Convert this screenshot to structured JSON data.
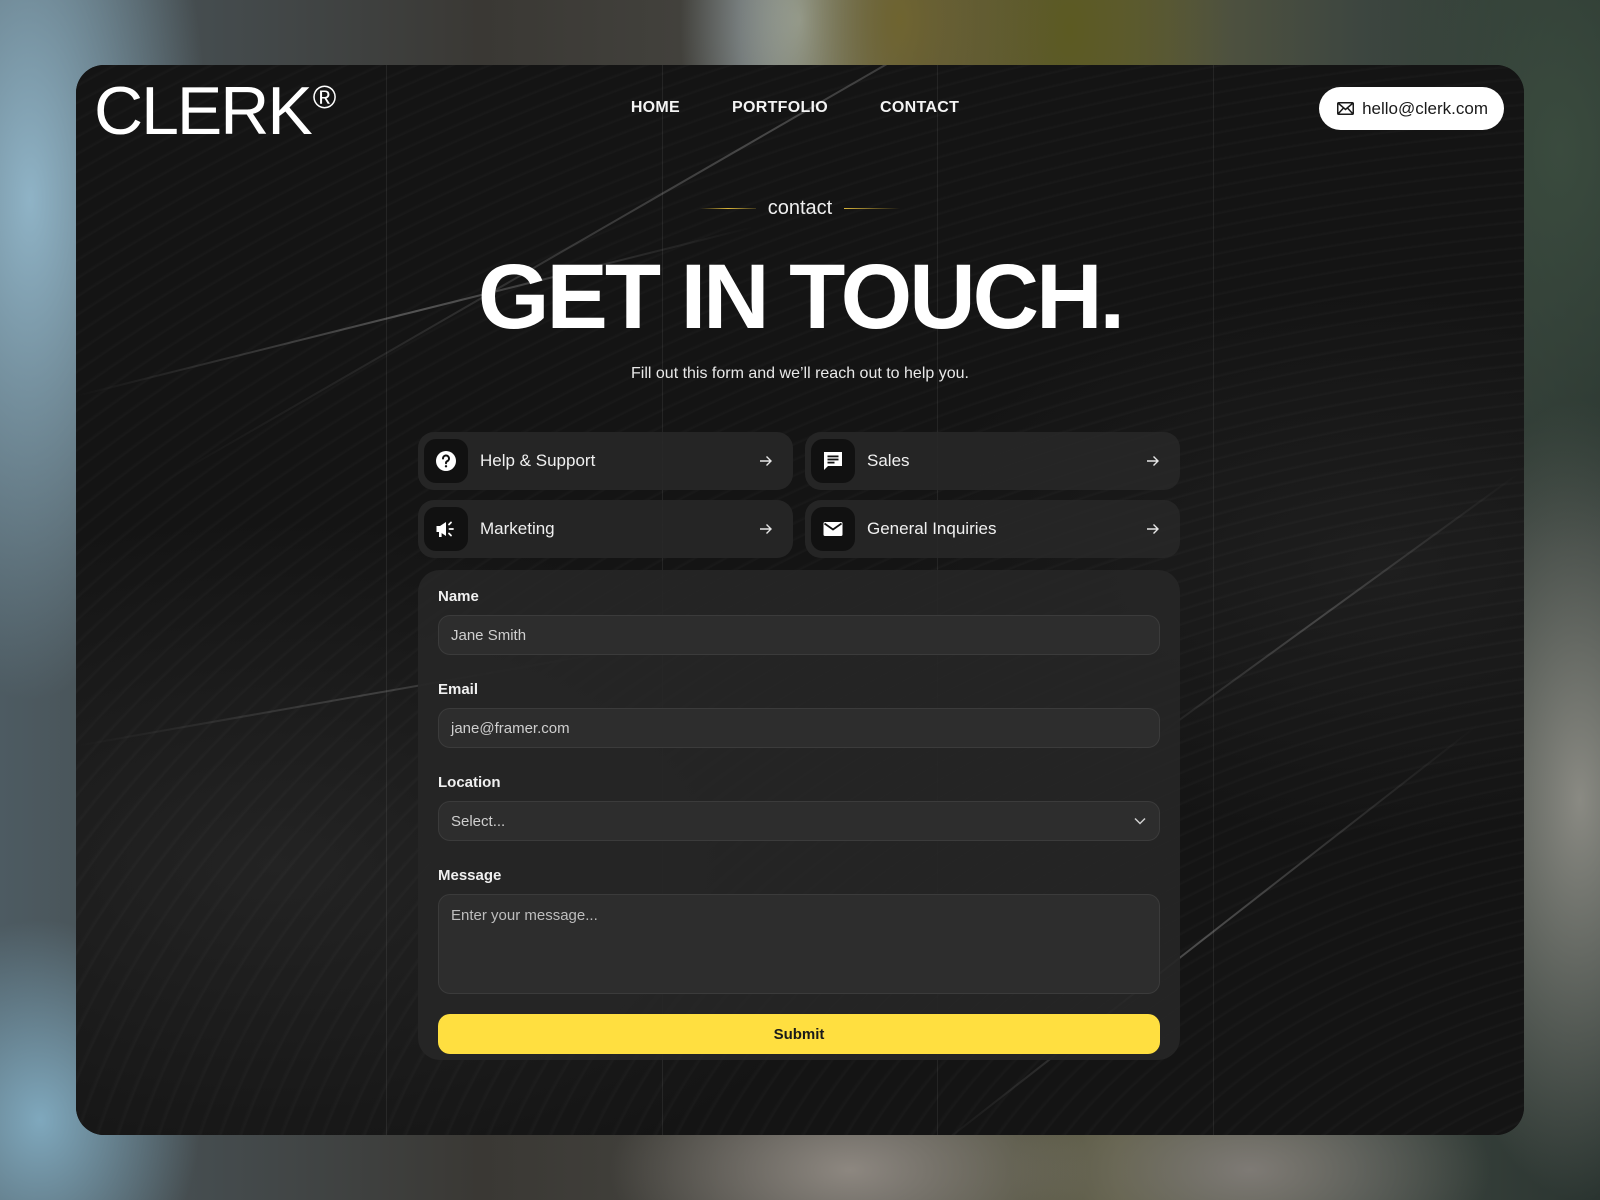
{
  "header": {
    "logo": "CLERK",
    "logo_mark": "®",
    "nav": [
      {
        "label": "HOME"
      },
      {
        "label": "PORTFOLIO"
      },
      {
        "label": "CONTACT"
      }
    ],
    "email_button": {
      "icon": "mail-outline-icon",
      "label": "hello@clerk.com"
    }
  },
  "hero": {
    "eyebrow": "contact",
    "title": "GET IN TOUCH.",
    "subtitle": "Fill out this form and we’ll reach out to help you."
  },
  "topics": [
    {
      "icon": "help-circle-icon",
      "label": "Help & Support",
      "arrow": "arrow-right-icon"
    },
    {
      "icon": "chat-bubble-icon",
      "label": "Sales",
      "arrow": "arrow-right-icon"
    },
    {
      "icon": "megaphone-icon",
      "label": "Marketing",
      "arrow": "arrow-right-icon"
    },
    {
      "icon": "mail-filled-icon",
      "label": "General Inquiries",
      "arrow": "arrow-right-icon"
    }
  ],
  "form": {
    "name": {
      "label": "Name",
      "placeholder": "Jane Smith",
      "value": ""
    },
    "email": {
      "label": "Email",
      "placeholder": "jane@framer.com",
      "value": ""
    },
    "location": {
      "label": "Location",
      "selected": "Select...",
      "icon": "chevron-down-icon"
    },
    "message": {
      "label": "Message",
      "placeholder": "Enter your message...",
      "value": ""
    },
    "submit_label": "Submit"
  },
  "colors": {
    "accent": "#FFDF40",
    "card_background": "#141414",
    "panel_background": "#262626",
    "eyebrow_line": "#D9B53A"
  }
}
